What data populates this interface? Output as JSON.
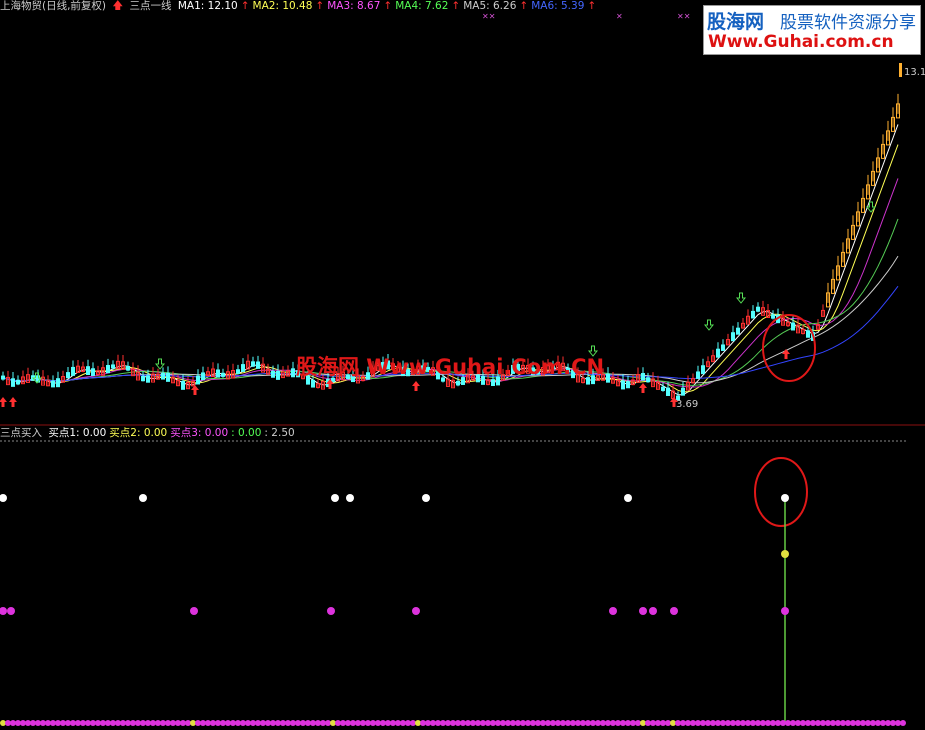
{
  "main_header": {
    "stock_name": "上海物贸(日线,前复权)",
    "indicator_name": "三点一线",
    "ma_labels": [
      {
        "label": "MA1: 12.10",
        "color": "#ffffff"
      },
      {
        "label": "MA2: 10.48",
        "color": "#ffff55"
      },
      {
        "label": "MA3: 8.67",
        "color": "#ff55ff"
      },
      {
        "label": "MA4: 7.62",
        "color": "#55ff55"
      },
      {
        "label": "MA5: 6.26",
        "color": "#cccccc"
      },
      {
        "label": "MA6: 5.39",
        "color": "#4466ff"
      }
    ],
    "up_arrow": "↑"
  },
  "sub_header": {
    "name": "三点买入",
    "items": [
      {
        "label": "买点1: 0.00",
        "color": "#ffffff"
      },
      {
        "label": "买点2: 0.00",
        "color": "#ffff55"
      },
      {
        "label": "买点3: 0.00",
        "color": "#ff55ff"
      },
      {
        "label": ": 0.00",
        "color": "#55ff55"
      },
      {
        "label": ": 2.50",
        "color": "#cccccc"
      }
    ]
  },
  "logo": {
    "title_cn": "股海网",
    "subtitle_cn": "股票软件资源分享",
    "url": "Www.Guhai.com.cn"
  },
  "watermark": "股海网 Www.Guhai.Com.CN",
  "price_labels": {
    "high": "13.1",
    "low": "3.69"
  },
  "colors": {
    "up_candle": "#ff3030",
    "down_candle": "#54ffff",
    "boom_candle": "#ffb030",
    "ma1": "#ffffff",
    "ma2": "#ffff55",
    "ma3": "#cc33cc",
    "ma4": "#55cc55",
    "ma5": "#cccccc",
    "ma6": "#3344ff",
    "buy_dot1": "#ffffff",
    "buy_dot2": "#e0e040",
    "buy_dot3": "#dd33dd",
    "signal_line": "#66cc44",
    "circle": "#e01818"
  },
  "chart_data": [
    {
      "type": "line",
      "title": "三点一线",
      "series": [
        {
          "name": "MA1",
          "last": 12.1
        },
        {
          "name": "MA2",
          "last": 10.48
        },
        {
          "name": "MA3",
          "last": 8.67
        },
        {
          "name": "MA4",
          "last": 7.62
        },
        {
          "name": "MA5",
          "last": 6.26
        },
        {
          "name": "MA6",
          "last": 5.39
        }
      ],
      "price_high": 13.1,
      "price_low": 3.69
    },
    {
      "type": "scatter",
      "title": "三点买入",
      "series": [
        {
          "name": "买点1",
          "last": 0.0
        },
        {
          "name": "买点2",
          "last": 0.0
        },
        {
          "name": "买点3",
          "last": 0.0
        }
      ],
      "ref_level": 2.5
    }
  ]
}
